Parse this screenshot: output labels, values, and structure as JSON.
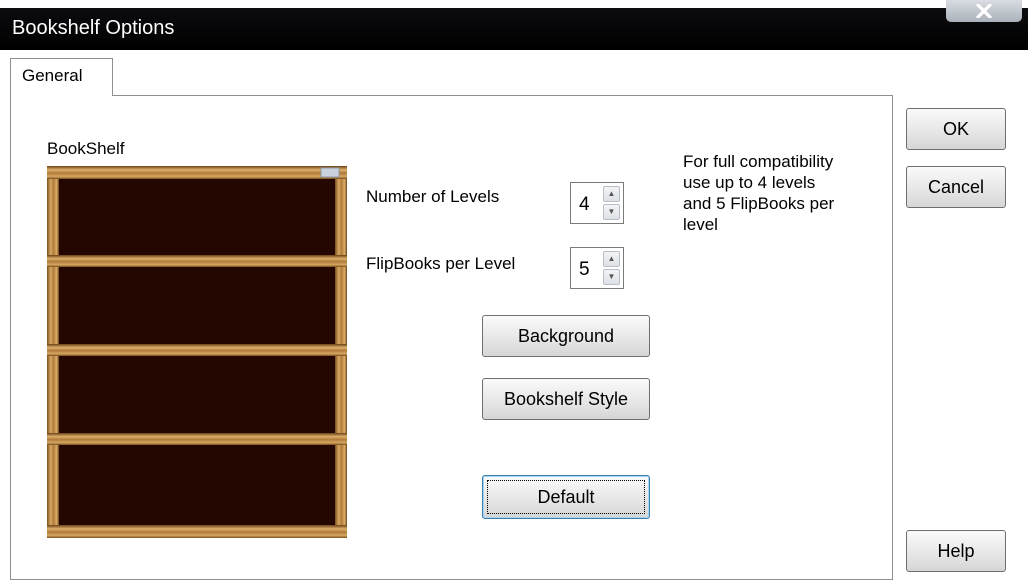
{
  "window": {
    "title": "Bookshelf Options",
    "close_glyph": "x"
  },
  "tabs": [
    {
      "label": "General"
    }
  ],
  "general": {
    "bookshelf_label": "BookShelf",
    "number_of_levels_label": "Number of Levels",
    "number_of_levels_value": "4",
    "flipbooks_per_level_label": "FlipBooks per Level",
    "flipbooks_per_level_value": "5",
    "background_button": "Background",
    "bookshelf_style_button": "Bookshelf Style",
    "default_button": "Default",
    "compat_note": [
      "For full compatibility",
      "use up to 4 levels",
      "and 5 FlipBooks per",
      "level"
    ]
  },
  "buttons": {
    "ok": "OK",
    "cancel": "Cancel",
    "help": "Help"
  },
  "shelf_preview": {
    "levels": 4
  },
  "colors": {
    "titlebar": "#000000",
    "shelf_back": "#230700",
    "wood": "#c89a56"
  }
}
